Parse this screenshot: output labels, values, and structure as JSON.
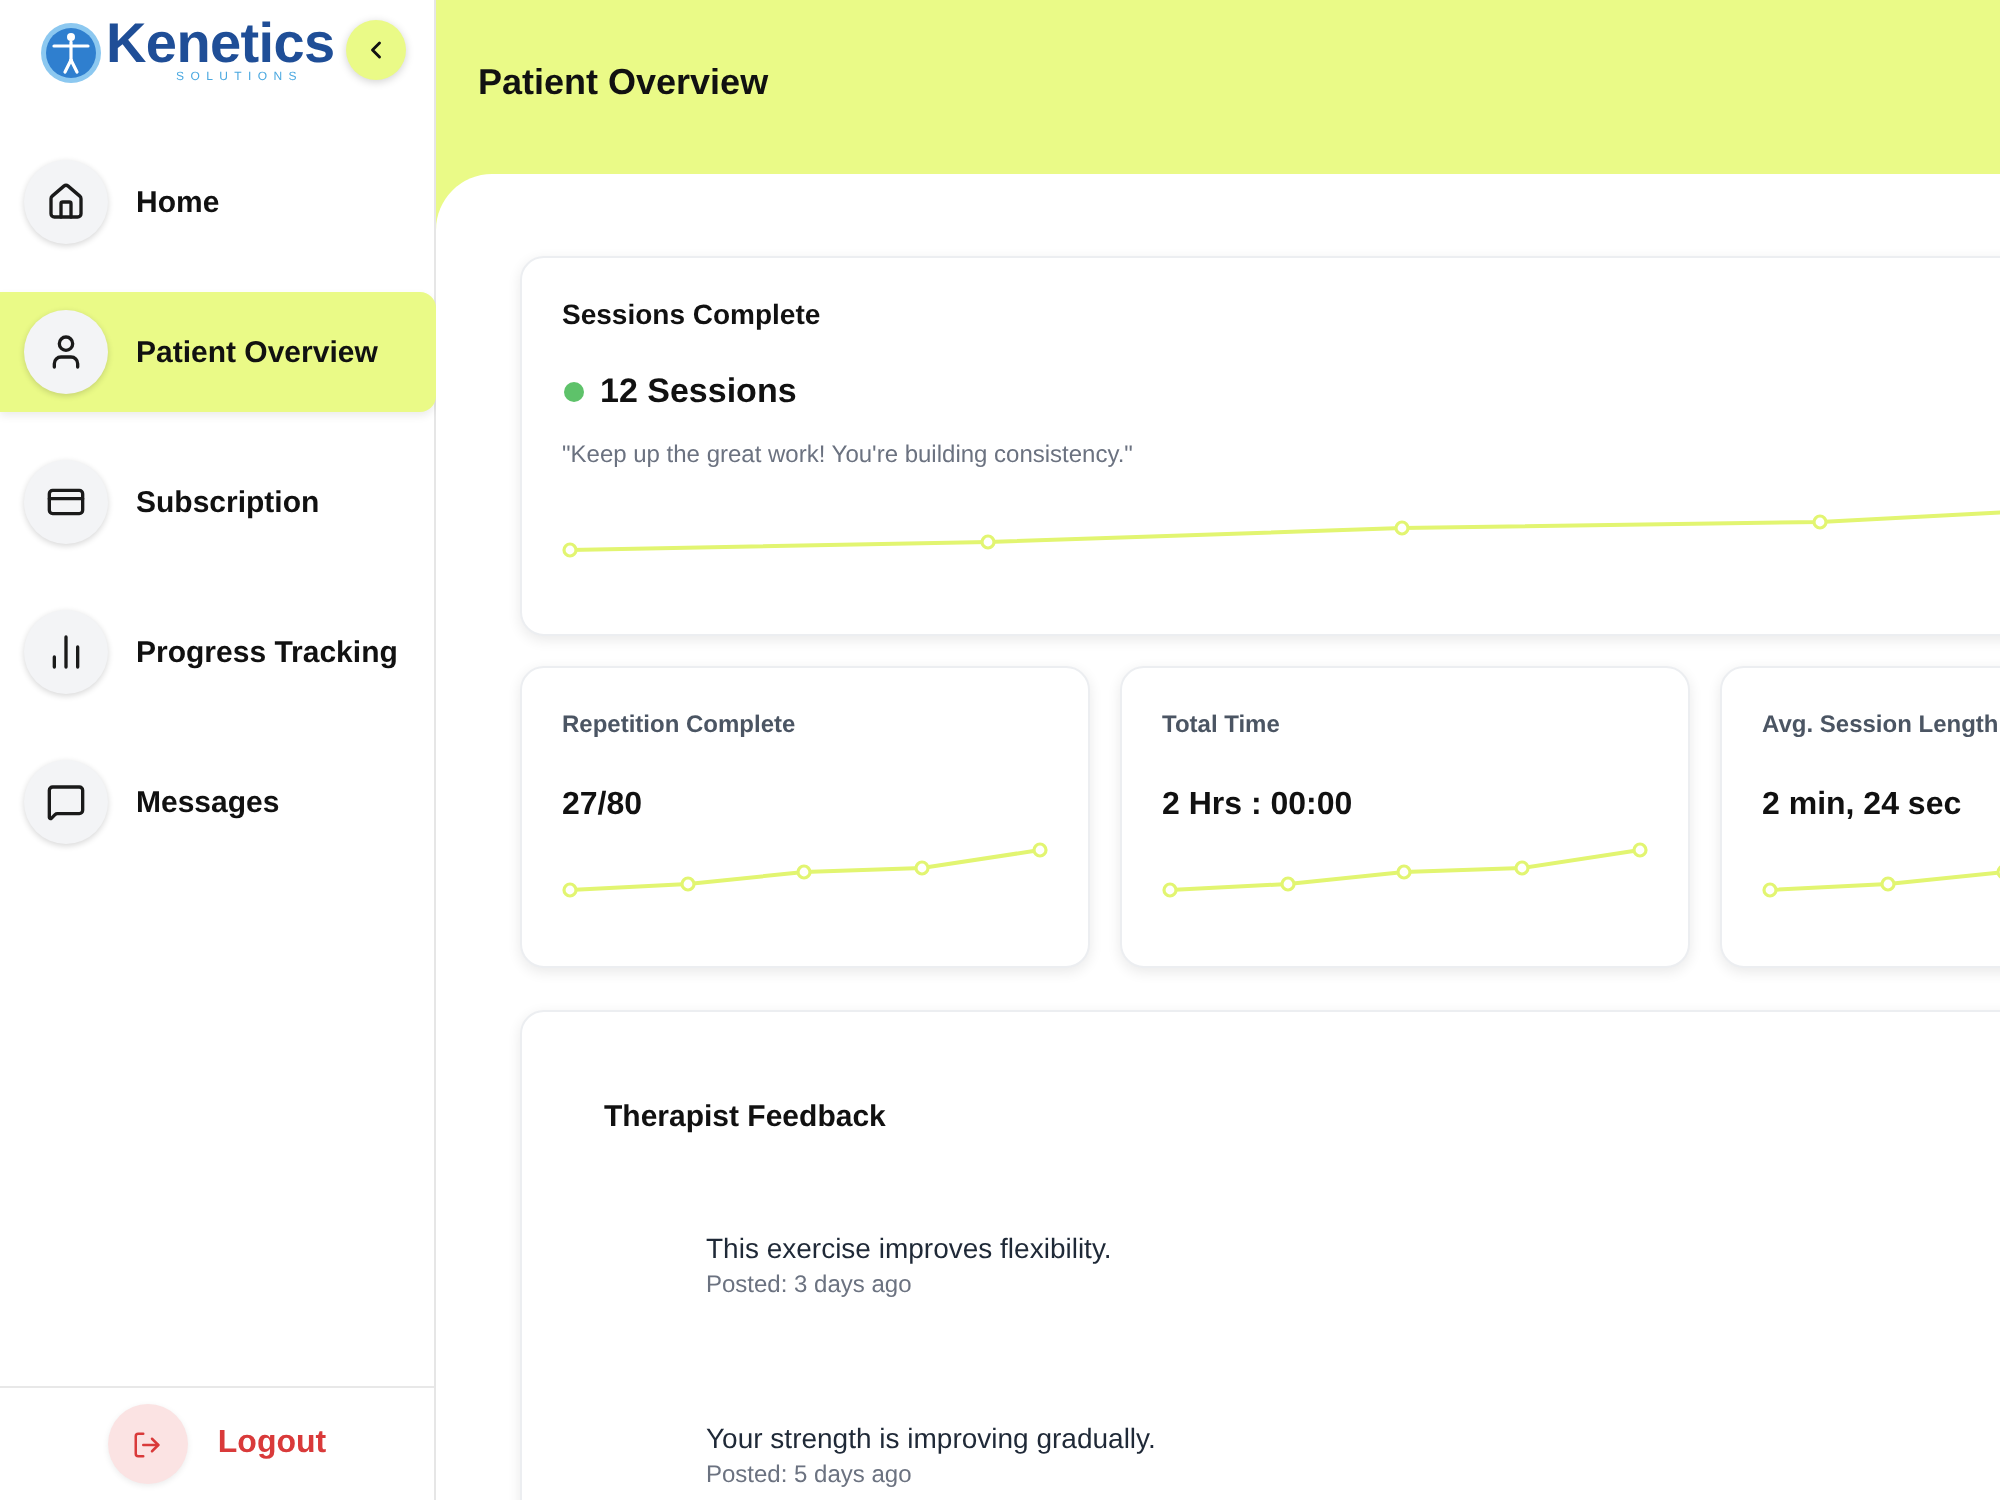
{
  "sidebar": {
    "logo": {
      "name": "Kenetics",
      "tagline": "SOLUTIONS"
    },
    "items": [
      {
        "label": "Home",
        "selected": false
      },
      {
        "label": "Patient Overview",
        "selected": true
      },
      {
        "label": "Subscription",
        "selected": false
      },
      {
        "label": "Progress Tracking",
        "selected": false
      },
      {
        "label": "Messages",
        "selected": false
      }
    ],
    "logout": {
      "label": "Logout"
    }
  },
  "header": {
    "title": "Patient Overview"
  },
  "sessions_card": {
    "title": "Sessions Complete",
    "value": "12 Sessions",
    "message": "\"Keep up the great work! You're building consistency.\""
  },
  "stat_cards": [
    {
      "title": "Repetition Complete",
      "value": "27/80"
    },
    {
      "title": "Total Time",
      "value": "2 Hrs : 00:00"
    },
    {
      "title": "Avg. Session Length",
      "value": "2 min, 24 sec"
    }
  ],
  "feedback": {
    "title": "Therapist Feedback",
    "items": [
      {
        "text": "This exercise improves flexibility.",
        "posted": "Posted: 3 days ago"
      },
      {
        "text": "Your strength is improving gradually.",
        "posted": "Posted: 5 days ago"
      }
    ]
  }
}
